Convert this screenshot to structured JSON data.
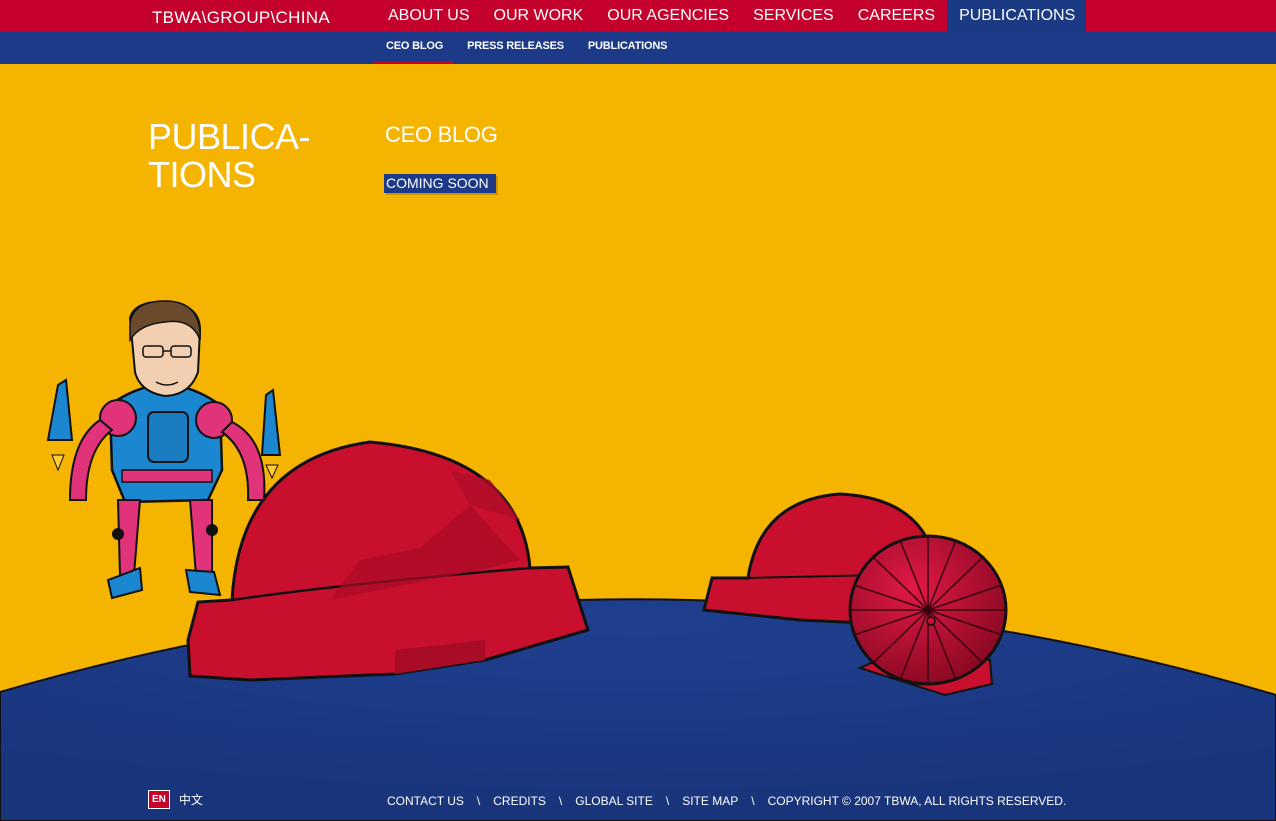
{
  "header": {
    "logo": "TBWA\\GROUP\\CHINA",
    "nav": [
      "ABOUT US",
      "OUR WORK",
      "OUR AGENCIES",
      "SERVICES",
      "CAREERS",
      "PUBLICATIONS"
    ],
    "active_nav": "PUBLICATIONS",
    "subnav": [
      "CEO BLOG",
      "PRESS RELEASES",
      "PUBLICATIONS"
    ],
    "active_subnav": "CEO BLOG"
  },
  "main": {
    "page_title_line1": "PUBLICA-",
    "page_title_line2": "TIONS",
    "section_title": "CEO BLOG",
    "status": "COMING SOON"
  },
  "footer": {
    "lang_en": "EN",
    "lang_zh": "中文",
    "links": [
      "CONTACT US",
      "CREDITS",
      "GLOBAL SITE",
      "SITE MAP"
    ],
    "separator": "\\",
    "copyright": "COPYRIGHT © 2007 TBWA, ALL RIGHTS RESERVED."
  },
  "colors": {
    "background": "#f4b400",
    "brand_red": "#c4002c",
    "navy": "#1d3a88"
  }
}
